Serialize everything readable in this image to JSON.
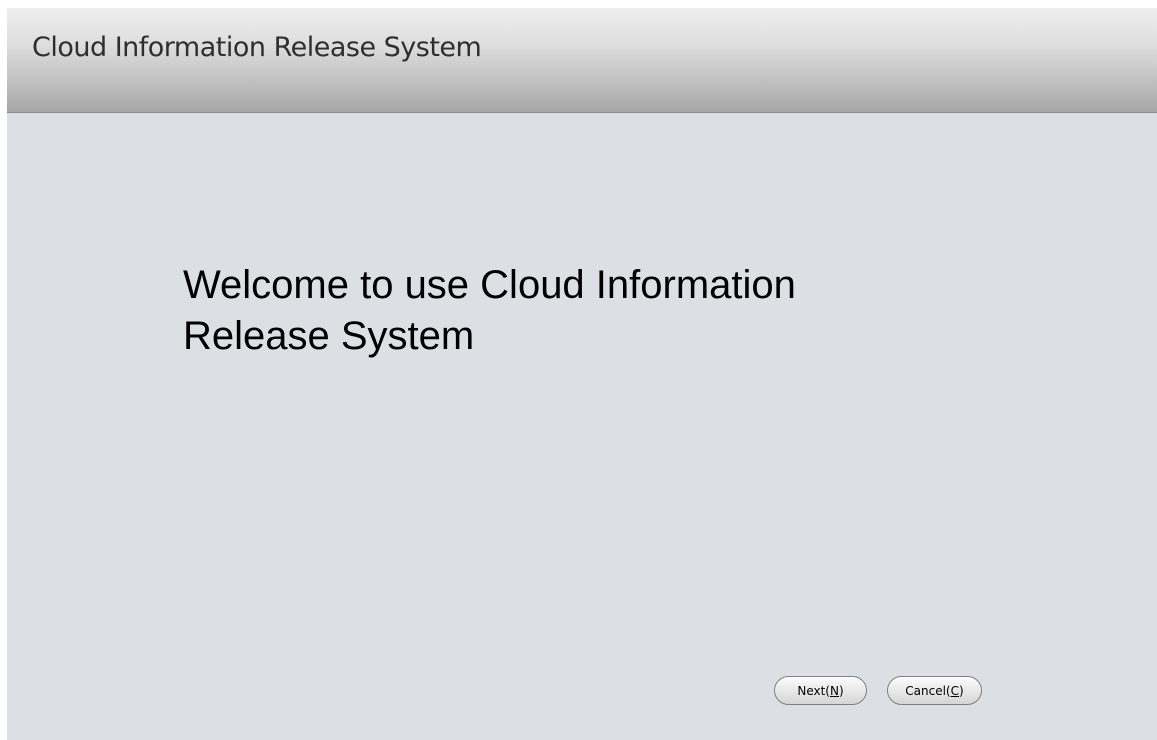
{
  "window": {
    "title": "Cloud Information Release System"
  },
  "main": {
    "welcome_text": "Welcome to use Cloud Information Release System"
  },
  "buttons": {
    "next": {
      "label": "Next(N)",
      "accelerator": "N"
    },
    "cancel": {
      "label": "Cancel(C)",
      "accelerator": "C"
    }
  }
}
